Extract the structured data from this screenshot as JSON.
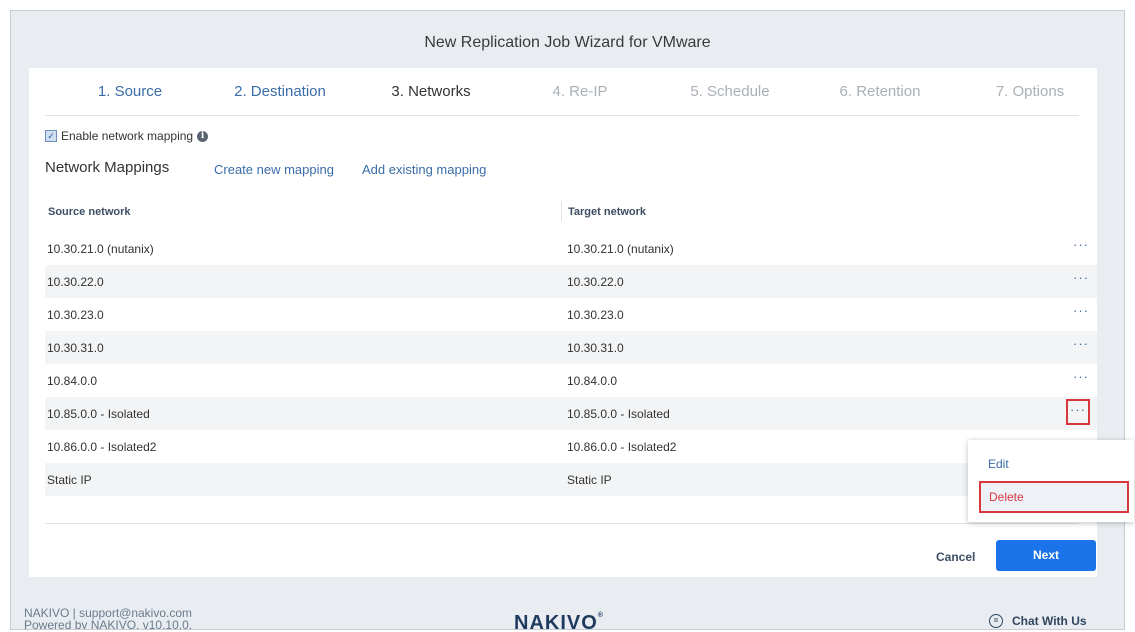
{
  "window": {
    "title": "New Replication Job Wizard for VMware"
  },
  "steps": [
    {
      "label": "1. Source",
      "state": "done"
    },
    {
      "label": "2. Destination",
      "state": "done"
    },
    {
      "label": "3. Networks",
      "state": "active"
    },
    {
      "label": "4. Re-IP",
      "state": "todo"
    },
    {
      "label": "5. Schedule",
      "state": "todo"
    },
    {
      "label": "6. Retention",
      "state": "todo"
    },
    {
      "label": "7. Options",
      "state": "todo"
    }
  ],
  "networks": {
    "enable_label": "Enable network mapping",
    "enable_checked": true,
    "section_title": "Network Mappings",
    "create_link": "Create new mapping",
    "add_link": "Add existing mapping",
    "columns": {
      "source": "Source network",
      "target": "Target network"
    },
    "rows": [
      {
        "source": "10.30.21.0 (nutanix)",
        "target": "10.30.21.0 (nutanix)"
      },
      {
        "source": "10.30.22.0",
        "target": "10.30.22.0"
      },
      {
        "source": "10.30.23.0",
        "target": "10.30.23.0"
      },
      {
        "source": "10.30.31.0",
        "target": "10.30.31.0"
      },
      {
        "source": "10.84.0.0",
        "target": "10.84.0.0"
      },
      {
        "source": "10.85.0.0 - Isolated",
        "target": "10.85.0.0 - Isolated"
      },
      {
        "source": "10.86.0.0 - Isolated2",
        "target": "10.86.0.0 - Isolated2"
      },
      {
        "source": "Static IP",
        "target": "Static IP"
      }
    ],
    "more_glyph": "···"
  },
  "context_menu": {
    "edit": "Edit",
    "delete": "Delete"
  },
  "actions": {
    "cancel": "Cancel",
    "next": "Next"
  },
  "footer": {
    "line1": "NAKIVO | support@nakivo.com",
    "line2": "Powered by NAKIVO, v10.10.0.",
    "logo": "NAKIVO",
    "logo_mark": "®",
    "chat": "Chat With Us"
  },
  "colors": {
    "accent": "#1a73e8",
    "link": "#3a6da8",
    "highlight": "#d9363e"
  }
}
